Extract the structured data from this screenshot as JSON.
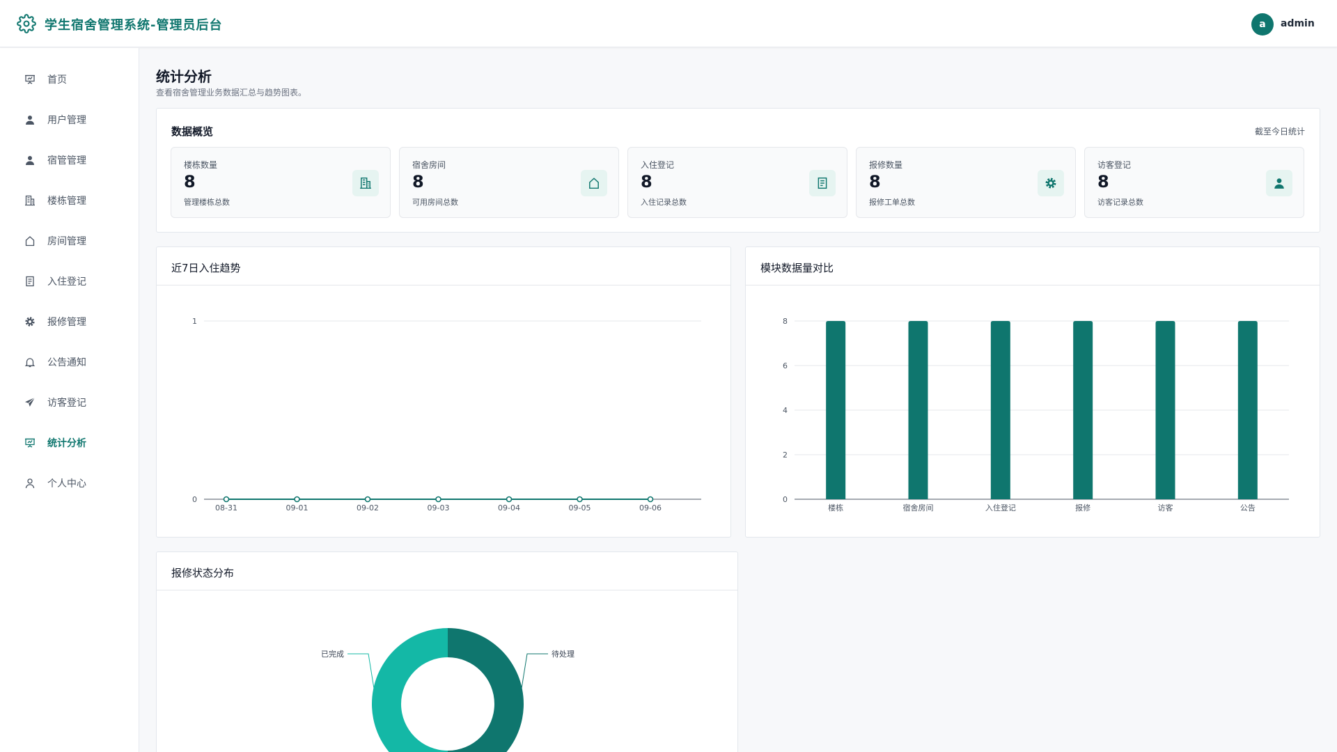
{
  "header": {
    "title": "学生宿舍管理系统-管理员后台",
    "avatar_letter": "a",
    "username": "admin",
    "accent": "#0f766e"
  },
  "sidebar": {
    "items": [
      {
        "label": "首页",
        "icon": "presentation-board-icon"
      },
      {
        "label": "用户管理",
        "icon": "user-icon"
      },
      {
        "label": "宿管管理",
        "icon": "user-icon"
      },
      {
        "label": "楼栋管理",
        "icon": "building-icon"
      },
      {
        "label": "房间管理",
        "icon": "home-icon"
      },
      {
        "label": "入住登记",
        "icon": "document-icon"
      },
      {
        "label": "报修管理",
        "icon": "gear-icon"
      },
      {
        "label": "公告通知",
        "icon": "bell-icon"
      },
      {
        "label": "访客登记",
        "icon": "paper-plane-icon"
      },
      {
        "label": "统计分析",
        "icon": "presentation-board-icon",
        "active": true
      },
      {
        "label": "个人中心",
        "icon": "user-outline-icon"
      }
    ]
  },
  "page": {
    "title": "统计分析",
    "subtitle": "查看宿舍管理业务数据汇总与趋势图表。"
  },
  "overview": {
    "title": "数据概览",
    "note": "截至今日统计",
    "stats": [
      {
        "label": "楼栋数量",
        "value": "8",
        "desc": "管理楼栋总数",
        "icon": "building-icon"
      },
      {
        "label": "宿舍房间",
        "value": "8",
        "desc": "可用房间总数",
        "icon": "home-icon"
      },
      {
        "label": "入住登记",
        "value": "8",
        "desc": "入住记录总数",
        "icon": "document-icon"
      },
      {
        "label": "报修数量",
        "value": "8",
        "desc": "报修工单总数",
        "icon": "gear-icon"
      },
      {
        "label": "访客登记",
        "value": "8",
        "desc": "访客记录总数",
        "icon": "user-icon"
      }
    ]
  },
  "panels": {
    "trend_title": "近7日入住趋势",
    "compare_title": "模块数据量对比",
    "repair_title": "报修状态分布"
  },
  "chart_data": [
    {
      "type": "line",
      "title": "近7日入住趋势",
      "x": [
        "08-31",
        "09-01",
        "09-02",
        "09-03",
        "09-04",
        "09-05",
        "09-06"
      ],
      "series": [
        {
          "values": [
            0,
            0,
            0,
            0,
            0,
            0,
            0
          ]
        }
      ],
      "ylim": [
        0,
        1
      ],
      "yticks": [
        0,
        1
      ],
      "grid": true,
      "color": "#0f766e"
    },
    {
      "type": "bar",
      "title": "模块数据量对比",
      "categories": [
        "楼栋",
        "宿舍房间",
        "入住登记",
        "报修",
        "访客",
        "公告"
      ],
      "values": [
        8,
        8,
        8,
        8,
        8,
        8
      ],
      "ylim": [
        0,
        8
      ],
      "yticks": [
        0,
        2,
        4,
        6,
        8
      ],
      "grid": true,
      "color": "#0f766e"
    },
    {
      "type": "pie",
      "title": "报修状态分布",
      "categories": [
        "待处理",
        "已完成"
      ],
      "values": [
        50,
        50
      ],
      "colors": [
        "#0f766e",
        "#14b8a6"
      ],
      "donut": true
    }
  ]
}
